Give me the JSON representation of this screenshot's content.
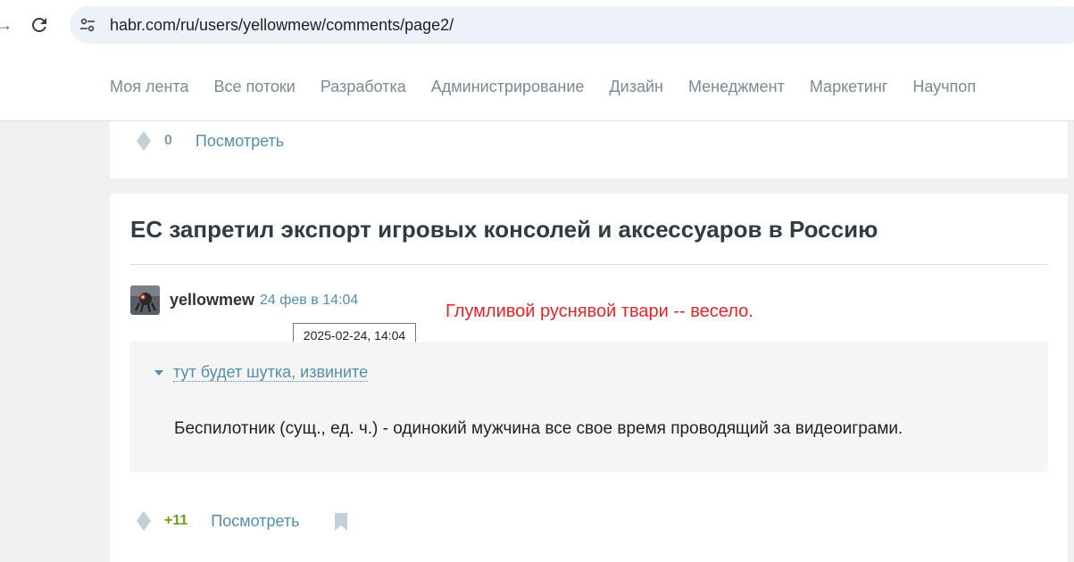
{
  "browser": {
    "url": "habr.com/ru/users/yellowmew/comments/page2/"
  },
  "nav": {
    "items": [
      "Моя лента",
      "Все потоки",
      "Разработка",
      "Администрирование",
      "Дизайн",
      "Менеджмент",
      "Маркетинг",
      "Научпоп"
    ]
  },
  "prev_comment": {
    "votes": "0",
    "view_label": "Посмотреть"
  },
  "comment": {
    "article_title": "ЕС запретил экспорт игровых консолей и аксессуаров в Россию",
    "author": "yellowmew",
    "time": "24 фев в 14:04",
    "tooltip": "2025-02-24, 14:04",
    "annotation": "Глумливой руснявой твари -- весело.",
    "spoiler_title": "тут будет шутка, извините",
    "spoiler_text": "Беспилотник (сущ., ед. ч.) - одинокий мужчина все свое время проводящий за видеоиграми.",
    "votes": "+11",
    "view_label": "Посмотреть"
  },
  "colors": {
    "link": "#548eaa",
    "positive_votes": "#6a9c1f",
    "annotation": "#e0262b"
  },
  "icons": [
    "reload-icon",
    "site-info-icon",
    "vote-icon",
    "bookmark-icon",
    "chevron-down-icon"
  ]
}
